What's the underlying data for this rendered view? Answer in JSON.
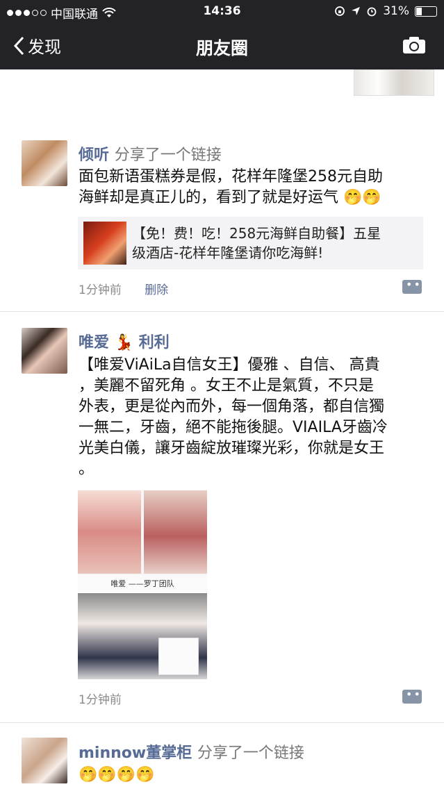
{
  "status_bar": {
    "carrier": "中国联通",
    "time": "14:36",
    "battery": "31%",
    "battery_fraction": 0.31
  },
  "nav": {
    "back_label": "发现",
    "title": "朋友圈"
  },
  "posts": [
    {
      "name": "倾听",
      "action": "分享了一个链接",
      "text_line1": "面包新语蛋糕券是假，花样年隆堡258元自助",
      "text_line2": "海鲜却是真正儿的，看到了就是好运气  🤭🤭",
      "link_title_line1": "【免！费！吃！258元海鲜自助餐】五星",
      "link_title_line2": "级酒店-花样年隆堡请你吃海鲜!",
      "time": "1分钟前",
      "delete_label": "删除"
    },
    {
      "name_part1": "唯爱",
      "name_emoji": "💃",
      "name_part2": "利利",
      "lines": [
        "【唯爱ViAiLa自信女王】優雅 、自信、 高貴",
        "，美麗不留死角 。女王不止是氣質，不只是",
        "外表，更是從內而外，每一個角落，都自信獨",
        "一無二，牙齒，絕不能拖後腿。VIAILA牙齒冷",
        "光美白儀，讓牙齒綻放璀璨光彩，你就是女王",
        "。"
      ],
      "image_caption": "唯爱 ——罗丁团队",
      "time": "1分钟前"
    },
    {
      "name": "minnow董掌柜",
      "action": "分享了一个链接",
      "text": "🤭🤭🤭🤭"
    }
  ]
}
